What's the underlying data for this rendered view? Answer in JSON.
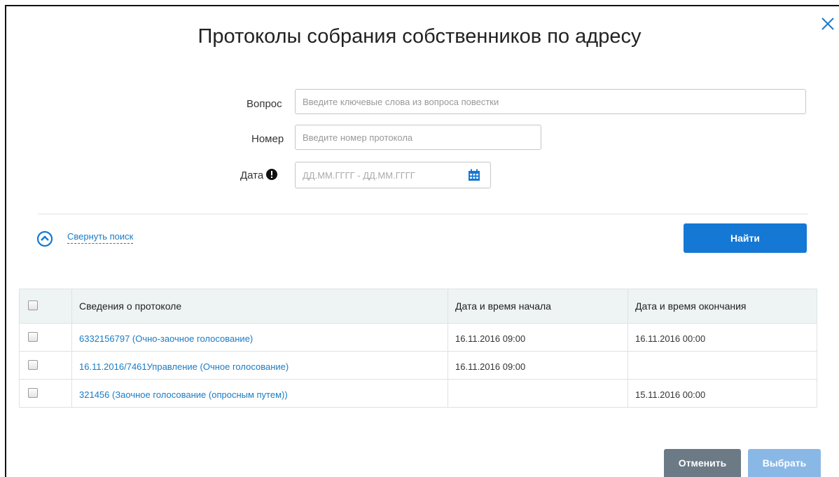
{
  "dialog": {
    "title": "Протоколы собрания собственников по адресу"
  },
  "form": {
    "question_label": "Вопрос",
    "question_placeholder": "Введите ключевые слова из вопроса повестки",
    "number_label": "Номер",
    "number_placeholder": "Введите номер протокола",
    "date_label": "Дата",
    "date_range_placeholder": "ДД.ММ.ГГГГ  -  ДД.ММ.ГГГГ",
    "collapse_label": "Свернуть поиск",
    "find_label": "Найти"
  },
  "table": {
    "columns": [
      "Сведения о протоколе",
      "Дата и время начала",
      "Дата и время окончания"
    ],
    "rows": [
      {
        "info": "6332156797 (Очно-заочное голосование)",
        "start": "16.11.2016 09:00",
        "end": "16.11.2016 00:00"
      },
      {
        "info": "16.11.2016/7461Управление (Очное голосование)",
        "start": "16.11.2016 09:00",
        "end": ""
      },
      {
        "info": "321456 (Заочное голосование (опросным путем))",
        "start": "",
        "end": "15.11.2016 00:00"
      }
    ]
  },
  "footer": {
    "cancel_label": "Отменить",
    "select_label": "Выбрать"
  },
  "colors": {
    "primary": "#1478d4",
    "link": "#1a7bc5",
    "cancel": "#6c7a86",
    "select_disabled": "#8ab8e6",
    "header_bg": "#eef3f4"
  },
  "icons": [
    "close-icon",
    "warning-icon",
    "calendar-icon",
    "chevron-up-icon"
  ]
}
